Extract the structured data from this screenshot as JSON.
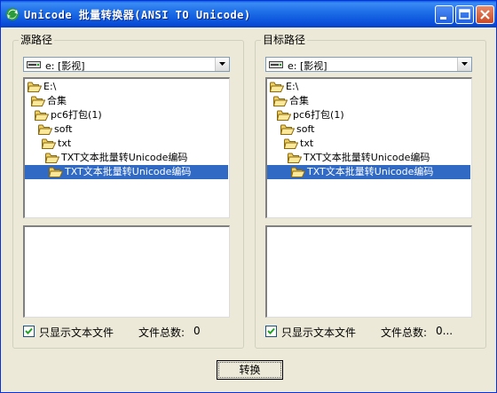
{
  "window": {
    "title": "Unicode 批量转换器(ANSI TO Unicode)",
    "icons": [
      "app-icon",
      "minimize-icon",
      "maximize-icon",
      "close-icon"
    ]
  },
  "source": {
    "group_label": "源路径",
    "drive": "e: [影视]",
    "dirs": [
      {
        "label": "E:\\",
        "open": true,
        "selected": false
      },
      {
        "label": "合集",
        "open": true,
        "selected": false
      },
      {
        "label": "pc6打包(1)",
        "open": true,
        "selected": false
      },
      {
        "label": "soft",
        "open": true,
        "selected": false
      },
      {
        "label": "txt",
        "open": true,
        "selected": false
      },
      {
        "label": "TXT文本批量转Unicode编码",
        "open": true,
        "selected": false
      },
      {
        "label": "TXT文本批量转Unicode编码",
        "open": true,
        "selected": true
      }
    ],
    "show_text_only_label": "只显示文本文件",
    "show_text_only_checked": true,
    "file_count_label": "文件总数:",
    "file_count_value": "0"
  },
  "target": {
    "group_label": "目标路径",
    "drive": "e: [影视]",
    "dirs": [
      {
        "label": "E:\\",
        "open": true,
        "selected": false
      },
      {
        "label": "合集",
        "open": true,
        "selected": false
      },
      {
        "label": "pc6打包(1)",
        "open": true,
        "selected": false
      },
      {
        "label": "soft",
        "open": true,
        "selected": false
      },
      {
        "label": "txt",
        "open": true,
        "selected": false
      },
      {
        "label": "TXT文本批量转Unicode编码",
        "open": true,
        "selected": false
      },
      {
        "label": "TXT文本批量转Unicode编码",
        "open": true,
        "selected": true
      }
    ],
    "show_text_only_label": "只显示文本文件",
    "show_text_only_checked": true,
    "file_count_label": "文件总数:",
    "file_count_value": "0..."
  },
  "actions": {
    "convert_label": "转换"
  }
}
